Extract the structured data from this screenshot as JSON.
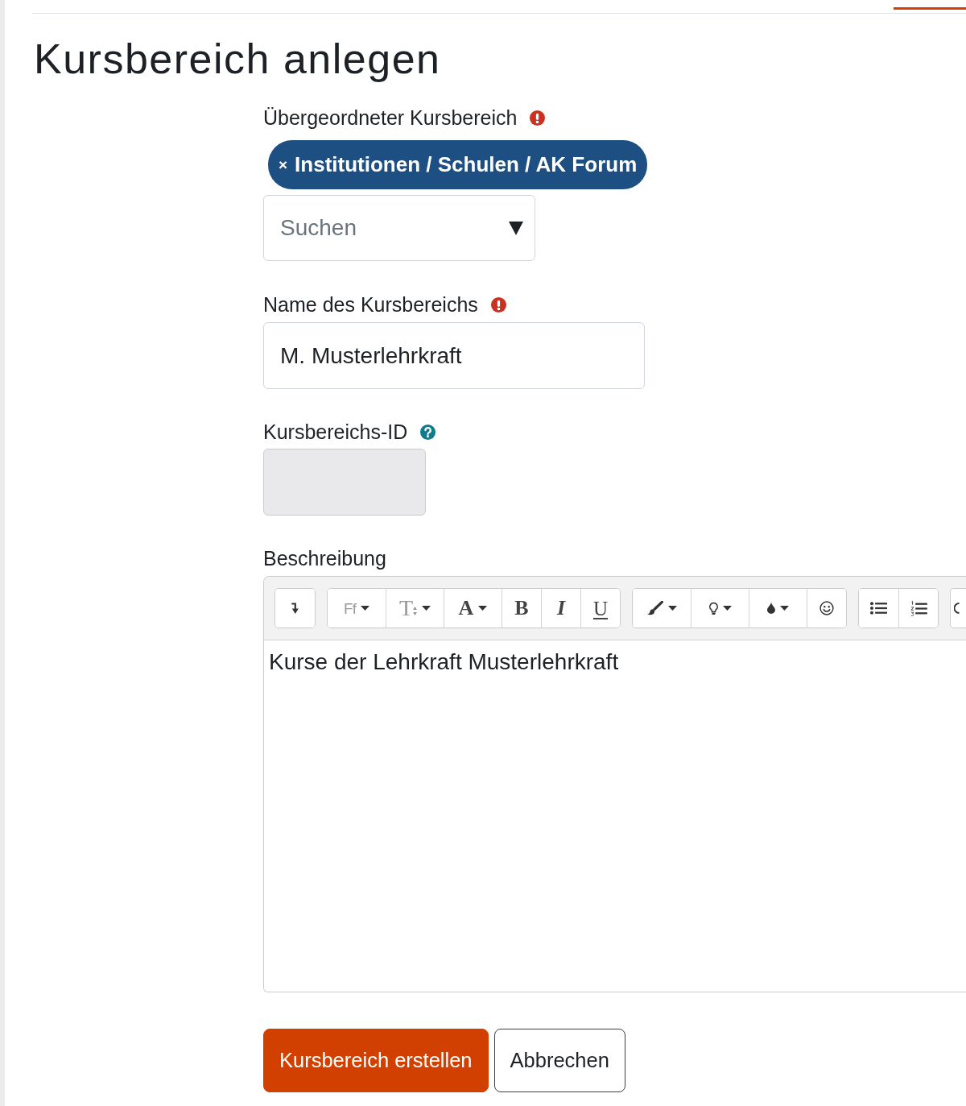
{
  "page": {
    "title": "Kursbereich anlegen"
  },
  "form": {
    "fields": [
      {
        "kind": "autocomplete",
        "label": "Übergeordneter Kursbereich",
        "required": true,
        "selection": {
          "remove_symbol": "×",
          "label": "Institutionen / Schulen / AK Forum"
        },
        "placeholder": "Suchen"
      },
      {
        "kind": "text",
        "label": "Name des Kursbereichs",
        "required": true,
        "value": "M. Musterlehrkraft",
        "disabled": false
      },
      {
        "kind": "text",
        "label": "Kursbereichs-ID",
        "help": true,
        "disabled": true
      },
      {
        "kind": "editor",
        "label": "Beschreibung",
        "toolbar": [
          [
            {
              "kind": "indent"
            }
          ],
          [
            {
              "kind": "font",
              "label": "Ff",
              "dropdown": true
            },
            {
              "kind": "size",
              "label": "T",
              "dropdown": true
            },
            {
              "kind": "color",
              "label": "A",
              "dropdown": true
            },
            {
              "kind": "bold",
              "label": "B"
            },
            {
              "kind": "italic",
              "label": "I"
            },
            {
              "kind": "underline",
              "label": "U"
            }
          ],
          [
            {
              "kind": "brush",
              "dropdown": true
            },
            {
              "kind": "highlight",
              "dropdown": true
            },
            {
              "kind": "drop",
              "dropdown": true
            },
            {
              "kind": "emoji"
            }
          ],
          [
            {
              "kind": "bullets"
            },
            {
              "kind": "numbering"
            }
          ],
          [
            {
              "kind": "partial"
            }
          ]
        ],
        "content": "Kurse der Lehrkraft Musterlehrkraft"
      }
    ],
    "buttons": [
      {
        "label": "Kursbereich erstellen",
        "primary": true
      },
      {
        "label": "Abbrechen",
        "primary": false
      }
    ]
  }
}
